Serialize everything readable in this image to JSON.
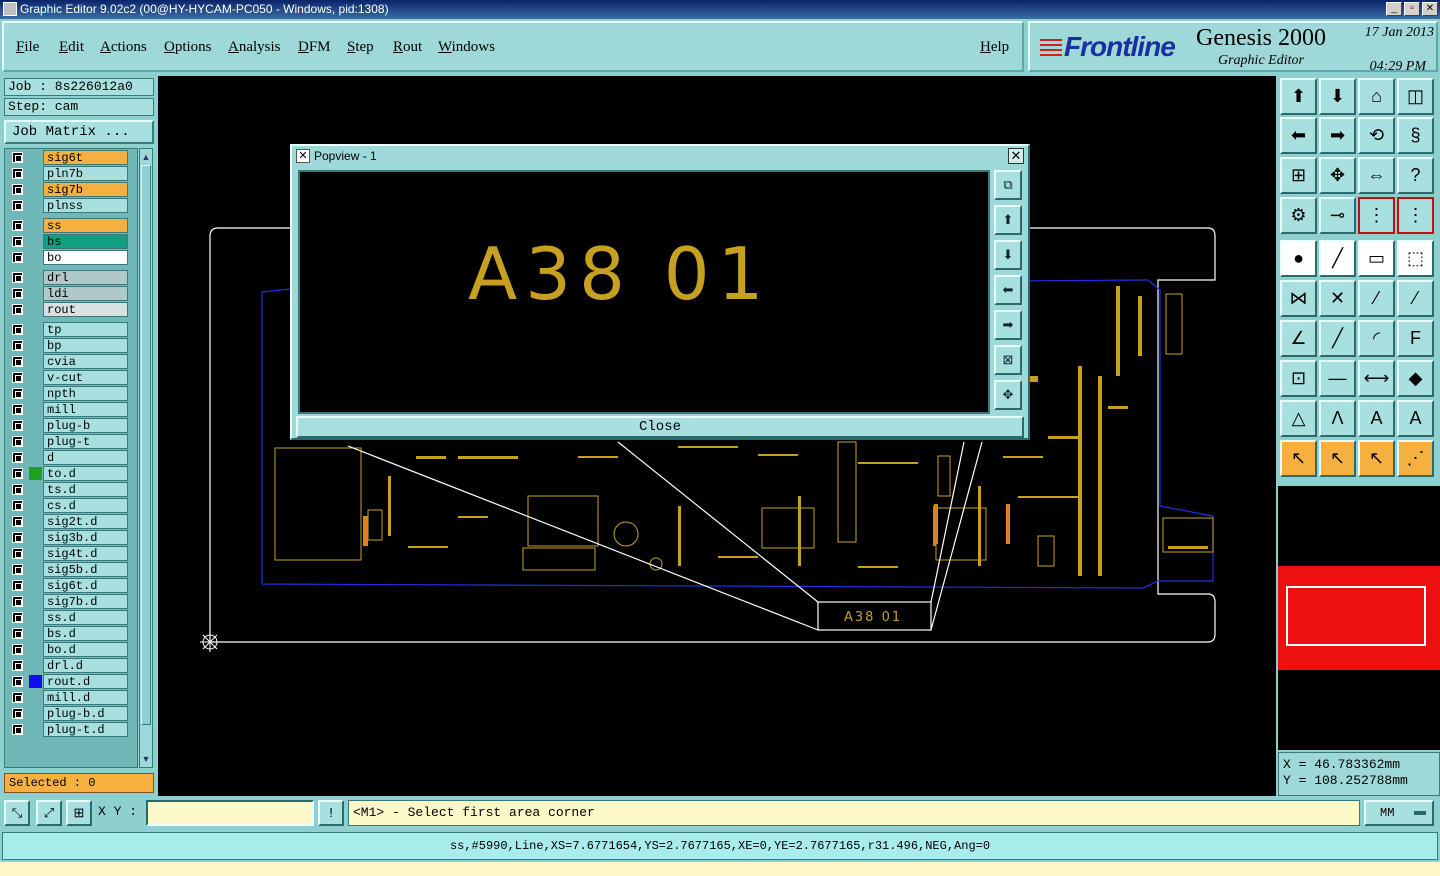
{
  "window": {
    "title": "Graphic Editor 9.02c2 (00@HY-HYCAM-PC050 - Windows, pid:1308)"
  },
  "menu": {
    "items": [
      "File",
      "Edit",
      "Actions",
      "Options",
      "Analysis",
      "DFM",
      "Step",
      "Rout",
      "Windows"
    ],
    "help": "Help"
  },
  "brand": {
    "logo": "Frontline",
    "product": "Genesis 2000",
    "subtitle": "Graphic Editor",
    "date": "17 Jan 2013",
    "time": "04:29 PM"
  },
  "job": {
    "job_label": "Job : 8s226012a0",
    "step_label": "Step: cam",
    "matrix_button": "Job Matrix ..."
  },
  "layers": [
    {
      "name": "sig6t",
      "color": "#f5b040",
      "group": 0
    },
    {
      "name": "pln7b",
      "color": "#a8e0e0",
      "group": 0
    },
    {
      "name": "sig7b",
      "color": "#f5b040",
      "group": 0
    },
    {
      "name": "plnss",
      "color": "#a8e0e0",
      "group": 0
    },
    {
      "name": "ss",
      "color": "#f5b040",
      "group": 1
    },
    {
      "name": "bs",
      "color": "#10a080",
      "group": 1
    },
    {
      "name": "bo",
      "color": "#ffffff",
      "group": 1
    },
    {
      "name": "drl",
      "color": "#b0c8c8",
      "group": 2
    },
    {
      "name": "ldi",
      "color": "#b0c8c8",
      "group": 2
    },
    {
      "name": "rout",
      "color": "#d8e0e0",
      "group": 2
    },
    {
      "name": "tp",
      "color": "#a8e0e0",
      "group": 3
    },
    {
      "name": "bp",
      "color": "#a8e0e0",
      "group": 3
    },
    {
      "name": "cvia",
      "color": "#a8e0e0",
      "group": 3
    },
    {
      "name": "v-cut",
      "color": "#a8e0e0",
      "group": 3
    },
    {
      "name": "npth",
      "color": "#a8e0e0",
      "group": 3
    },
    {
      "name": "mill",
      "color": "#a8e0e0",
      "group": 3
    },
    {
      "name": "plug-b",
      "color": "#a8e0e0",
      "group": 3
    },
    {
      "name": "plug-t",
      "color": "#a8e0e0",
      "group": 3
    },
    {
      "name": "d",
      "color": "#a8e0e0",
      "group": 3
    },
    {
      "name": "to.d",
      "color": "#a8e0e0",
      "group": 3,
      "swatch": "#20a020"
    },
    {
      "name": "ts.d",
      "color": "#a8e0e0",
      "group": 3
    },
    {
      "name": "cs.d",
      "color": "#a8e0e0",
      "group": 3
    },
    {
      "name": "sig2t.d",
      "color": "#a8e0e0",
      "group": 3
    },
    {
      "name": "sig3b.d",
      "color": "#a8e0e0",
      "group": 3
    },
    {
      "name": "sig4t.d",
      "color": "#a8e0e0",
      "group": 3
    },
    {
      "name": "sig5b.d",
      "color": "#a8e0e0",
      "group": 3
    },
    {
      "name": "sig6t.d",
      "color": "#a8e0e0",
      "group": 3
    },
    {
      "name": "sig7b.d",
      "color": "#a8e0e0",
      "group": 3
    },
    {
      "name": "ss.d",
      "color": "#a8e0e0",
      "group": 3
    },
    {
      "name": "bs.d",
      "color": "#a8e0e0",
      "group": 3
    },
    {
      "name": "bo.d",
      "color": "#a8e0e0",
      "group": 3
    },
    {
      "name": "drl.d",
      "color": "#a8e0e0",
      "group": 3
    },
    {
      "name": "rout.d",
      "color": "#a8e0e0",
      "group": 3,
      "swatch": "#1010ee"
    },
    {
      "name": "mill.d",
      "color": "#a8e0e0",
      "group": 3
    },
    {
      "name": "plug-b.d",
      "color": "#a8e0e0",
      "group": 3
    },
    {
      "name": "plug-t.d",
      "color": "#a8e0e0",
      "group": 3
    }
  ],
  "selected": "Selected : 0",
  "popview": {
    "title": "Popview - 1",
    "text": "A38 01",
    "close_label": "Close",
    "close_x": "✕"
  },
  "canvas": {
    "label": "A38 01"
  },
  "coords": {
    "x": "X = 46.783362mm",
    "y": "Y = 108.252788mm"
  },
  "status": {
    "xy_label": "X Y :",
    "xy_value": "",
    "prompt": "<M1> - Select first area corner",
    "units": "MM",
    "info": "ss,#5990,Line,XS=7.6771654,YS=2.7677165,XE=0,YE=2.7677165,r31.496,NEG,Ang=0"
  },
  "colors": {
    "accent": "#9ed8d8",
    "selected": "#f5b040",
    "board_text": "#c8a020"
  }
}
